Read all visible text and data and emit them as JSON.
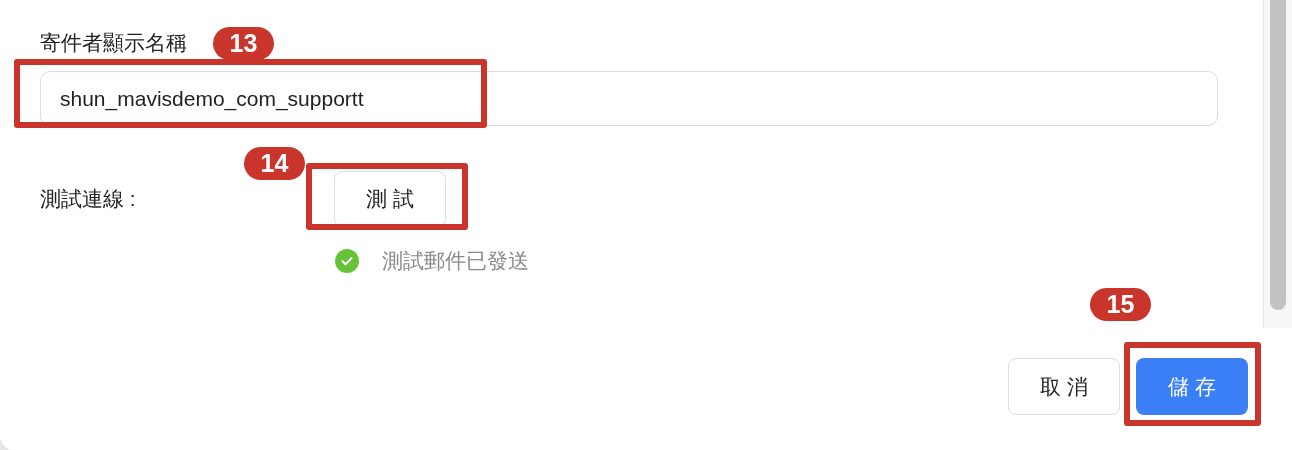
{
  "sender_name": {
    "label": "寄件者顯示名稱",
    "badge": "13",
    "value": "shun_mavisdemo_com_supportt"
  },
  "test_connection": {
    "label": "測試連線 :",
    "badge": "14",
    "button": "測 試",
    "status": {
      "ok": true,
      "text": "測試郵件已發送"
    }
  },
  "footer": {
    "badge": "15",
    "buttons": [
      {
        "label": "取 消",
        "kind": "secondary"
      },
      {
        "label": "儲 存",
        "kind": "primary"
      }
    ]
  }
}
